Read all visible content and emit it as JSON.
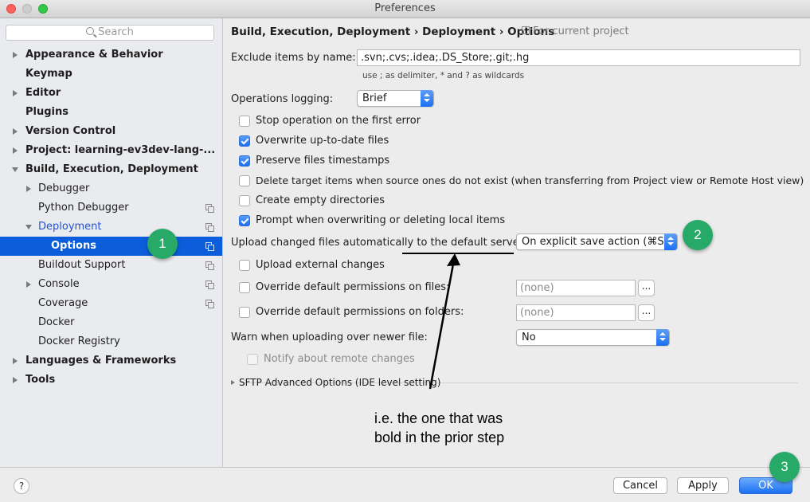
{
  "window": {
    "title": "Preferences"
  },
  "sidebar": {
    "search_placeholder": "Search",
    "items": [
      {
        "label": "Appearance & Behavior"
      },
      {
        "label": "Keymap"
      },
      {
        "label": "Editor"
      },
      {
        "label": "Plugins"
      },
      {
        "label": "Version Control"
      },
      {
        "label": "Project: learning-ev3dev-lang-..."
      },
      {
        "label": "Build, Execution, Deployment"
      },
      {
        "label": "Debugger"
      },
      {
        "label": "Python Debugger"
      },
      {
        "label": "Deployment"
      },
      {
        "label": "Options"
      },
      {
        "label": "Buildout Support"
      },
      {
        "label": "Console"
      },
      {
        "label": "Coverage"
      },
      {
        "label": "Docker"
      },
      {
        "label": "Docker Registry"
      },
      {
        "label": "Languages & Frameworks"
      },
      {
        "label": "Tools"
      }
    ]
  },
  "header": {
    "crumb1": "Build, Execution, Deployment",
    "crumb2": "Deployment",
    "crumb3": "Options",
    "separator": "›",
    "for_project": "For current project"
  },
  "form": {
    "exclude_label": "Exclude items by name:",
    "exclude_value": ".svn;.cvs;.idea;.DS_Store;.git;.hg",
    "exclude_hint": "use ; as delimiter, * and ? as wildcards",
    "logging_label": "Operations logging:",
    "logging_value": "Brief",
    "checkboxes": [
      {
        "label": "Stop operation on the first error"
      },
      {
        "label": "Overwrite up-to-date files"
      },
      {
        "label": "Preserve files timestamps"
      },
      {
        "label": "Delete target items when source ones do not exist (when transferring from Project view or Remote Host view)"
      },
      {
        "label": "Create empty directories"
      },
      {
        "label": "Prompt when overwriting or deleting local items"
      }
    ],
    "upload_label": "Upload changed files automatically to the default server",
    "upload_value": "On explicit save action (⌘S)",
    "upload_external_label": "Upload external changes",
    "override_files_label": "Override default permissions on files:",
    "override_files_value": "(none)",
    "override_folders_label": "Override default permissions on folders:",
    "override_folders_value": "(none)",
    "dots": "...",
    "warn_label": "Warn when uploading over newer file:",
    "warn_value": "No",
    "notify_label": "Notify about remote changes",
    "sftp_label": "SFTP Advanced Options (IDE level setting)"
  },
  "buttons": {
    "help": "?",
    "cancel": "Cancel",
    "apply": "Apply",
    "ok": "OK"
  },
  "annotations": {
    "callout1": "1",
    "callout2": "2",
    "callout3": "3",
    "note_line1": "i.e. the one that was",
    "note_line2": "bold in the prior step"
  }
}
